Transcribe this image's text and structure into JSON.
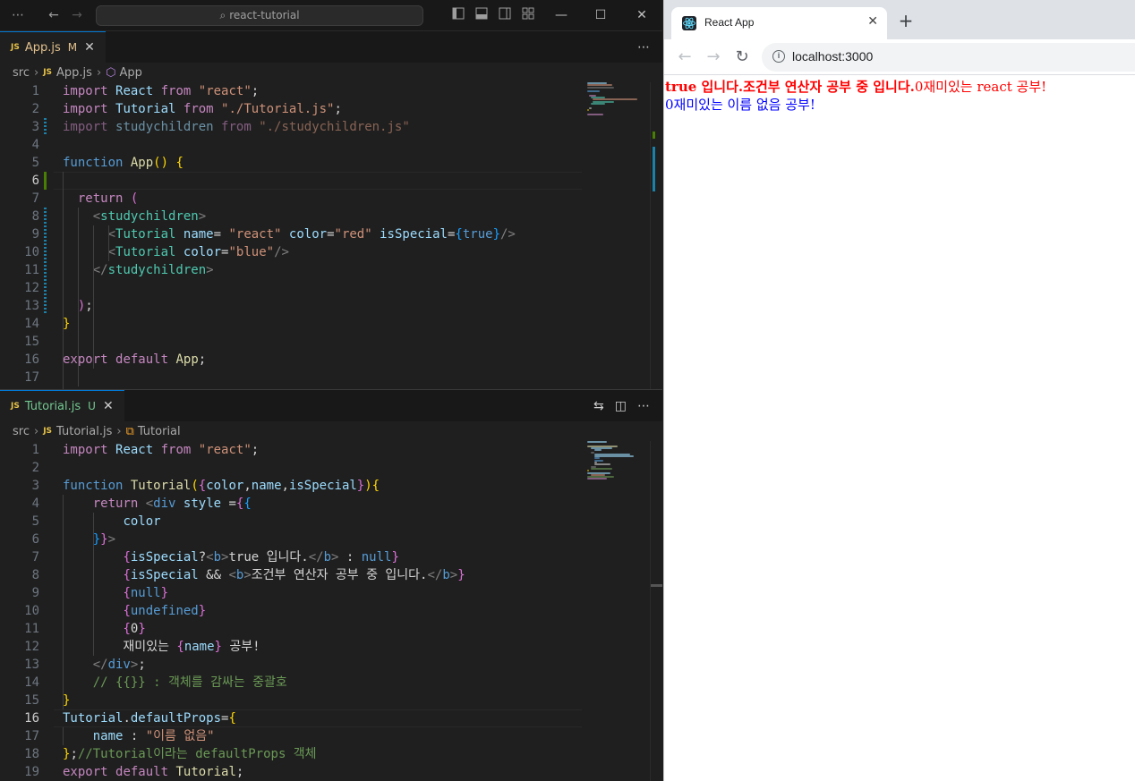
{
  "vscode": {
    "search_text": "react-tutorial",
    "top_pane": {
      "tab": {
        "filename": "App.js",
        "state": "M"
      },
      "breadcrumb": {
        "folder": "src",
        "file": "App.js",
        "symbol": "App"
      },
      "line_numbers": [
        "1",
        "2",
        "3",
        "4",
        "5",
        "6",
        "7",
        "8",
        "9",
        "10",
        "11",
        "12",
        "13",
        "14",
        "15",
        "16",
        "17"
      ],
      "current_line": "6"
    },
    "bottom_pane": {
      "tab": {
        "filename": "Tutorial.js",
        "state": "U"
      },
      "breadcrumb": {
        "folder": "src",
        "file": "Tutorial.js",
        "symbol": "Tutorial"
      },
      "line_numbers": [
        "1",
        "2",
        "3",
        "4",
        "5",
        "6",
        "7",
        "8",
        "9",
        "10",
        "11",
        "12",
        "13",
        "14",
        "15",
        "16",
        "17",
        "18",
        "19"
      ],
      "current_line": "16"
    }
  },
  "chrome": {
    "tab_title": "React App",
    "url": "localhost:3000",
    "output": {
      "line1_bold_true": "true",
      "line1_bold_1": " 입니다.",
      "line1_bold_2": "조건부 연산자 공부 중 입니다.",
      "line1_rest": "0재미있는 react 공부!",
      "line1_color": "#ff0000",
      "line2": "0재미있는 이름 없음 공부!",
      "line2_color": "#0000ff"
    }
  },
  "code_top": [
    [
      [
        "kc",
        "import"
      ],
      [
        "tx",
        " "
      ],
      [
        "vr",
        "React"
      ],
      [
        "tx",
        " "
      ],
      [
        "kc",
        "from"
      ],
      [
        "tx",
        " "
      ],
      [
        "st",
        "\"react\""
      ],
      [
        "tx",
        ";"
      ]
    ],
    [
      [
        "kc",
        "import"
      ],
      [
        "tx",
        " "
      ],
      [
        "vr",
        "Tutorial"
      ],
      [
        "tx",
        " "
      ],
      [
        "kc",
        "from"
      ],
      [
        "tx",
        " "
      ],
      [
        "st",
        "\"./Tutorial.js\""
      ],
      [
        "tx",
        ";"
      ]
    ],
    [
      [
        "kc dim",
        "import"
      ],
      [
        "tx",
        " "
      ],
      [
        "vr dim",
        "studychildren"
      ],
      [
        "tx",
        " "
      ],
      [
        "kc dim",
        "from"
      ],
      [
        "tx",
        " "
      ],
      [
        "st dim",
        "\"./studychildren.js\""
      ]
    ],
    [],
    [
      [
        "kw",
        "function"
      ],
      [
        "tx",
        " "
      ],
      [
        "fn",
        "App"
      ],
      [
        "br1",
        "()"
      ],
      [
        "tx",
        " "
      ],
      [
        "br1",
        "{"
      ]
    ],
    [],
    [
      [
        "tx",
        "  "
      ],
      [
        "kc",
        "return"
      ],
      [
        "tx",
        " "
      ],
      [
        "br2",
        "("
      ]
    ],
    [
      [
        "tx",
        "    "
      ],
      [
        "pt",
        "<"
      ],
      [
        "tg",
        "studychildren"
      ],
      [
        "pt",
        ">"
      ]
    ],
    [
      [
        "tx",
        "      "
      ],
      [
        "pt",
        "<"
      ],
      [
        "tg",
        "Tutorial"
      ],
      [
        "tx",
        " "
      ],
      [
        "vr",
        "name"
      ],
      [
        "tx",
        "= "
      ],
      [
        "st",
        "\"react\""
      ],
      [
        "tx",
        " "
      ],
      [
        "vr",
        "color"
      ],
      [
        "tx",
        "="
      ],
      [
        "st",
        "\"red\""
      ],
      [
        "tx",
        " "
      ],
      [
        "vr",
        "isSpecial"
      ],
      [
        "tx",
        "="
      ],
      [
        "br3",
        "{"
      ],
      [
        "kw",
        "true"
      ],
      [
        "br3",
        "}"
      ],
      [
        "pt",
        "/>"
      ]
    ],
    [
      [
        "tx",
        "      "
      ],
      [
        "pt",
        "<"
      ],
      [
        "tg",
        "Tutorial"
      ],
      [
        "tx",
        " "
      ],
      [
        "vr",
        "color"
      ],
      [
        "tx",
        "="
      ],
      [
        "st",
        "\"blue\""
      ],
      [
        "pt",
        "/>"
      ]
    ],
    [
      [
        "tx",
        "    "
      ],
      [
        "pt",
        "</"
      ],
      [
        "tg",
        "studychildren"
      ],
      [
        "pt",
        ">"
      ]
    ],
    [],
    [
      [
        "tx",
        "  "
      ],
      [
        "br2",
        ")"
      ],
      [
        "tx",
        ";"
      ]
    ],
    [
      [
        "br1",
        "}"
      ]
    ],
    [],
    [
      [
        "kc",
        "export"
      ],
      [
        "tx",
        " "
      ],
      [
        "kc",
        "default"
      ],
      [
        "tx",
        " "
      ],
      [
        "fn",
        "App"
      ],
      [
        "tx",
        ";"
      ]
    ],
    []
  ],
  "code_bottom": [
    [
      [
        "kc",
        "import"
      ],
      [
        "tx",
        " "
      ],
      [
        "vr",
        "React"
      ],
      [
        "tx",
        " "
      ],
      [
        "kc",
        "from"
      ],
      [
        "tx",
        " "
      ],
      [
        "st",
        "\"react\""
      ],
      [
        "tx",
        ";"
      ]
    ],
    [],
    [
      [
        "kw",
        "function"
      ],
      [
        "tx",
        " "
      ],
      [
        "fn",
        "Tutorial"
      ],
      [
        "br1",
        "("
      ],
      [
        "br2",
        "{"
      ],
      [
        "vr",
        "color"
      ],
      [
        "tx",
        ","
      ],
      [
        "vr",
        "name"
      ],
      [
        "tx",
        ","
      ],
      [
        "vr",
        "isSpecial"
      ],
      [
        "br2",
        "}"
      ],
      [
        "br1",
        ")"
      ],
      [
        "br1",
        "{"
      ]
    ],
    [
      [
        "tx",
        "    "
      ],
      [
        "kc",
        "return"
      ],
      [
        "tx",
        " "
      ],
      [
        "pt",
        "<"
      ],
      [
        "kw",
        "div"
      ],
      [
        "tx",
        " "
      ],
      [
        "vr",
        "style"
      ],
      [
        "tx",
        " ="
      ],
      [
        "br2",
        "{"
      ],
      [
        "br3",
        "{"
      ]
    ],
    [
      [
        "tx",
        "        "
      ],
      [
        "vr",
        "color"
      ]
    ],
    [
      [
        "tx",
        "    "
      ],
      [
        "br3",
        "}"
      ],
      [
        "br2",
        "}"
      ],
      [
        "pt",
        ">"
      ]
    ],
    [
      [
        "tx",
        "        "
      ],
      [
        "br2",
        "{"
      ],
      [
        "vr",
        "isSpecial"
      ],
      [
        "tx",
        "?"
      ],
      [
        "pt",
        "<"
      ],
      [
        "kw",
        "b"
      ],
      [
        "pt",
        ">"
      ],
      [
        "tx",
        "true 입니다."
      ],
      [
        "pt",
        "</"
      ],
      [
        "kw",
        "b"
      ],
      [
        "pt",
        ">"
      ],
      [
        "tx",
        " : "
      ],
      [
        "kw",
        "null"
      ],
      [
        "br2",
        "}"
      ]
    ],
    [
      [
        "tx",
        "        "
      ],
      [
        "br2",
        "{"
      ],
      [
        "vr",
        "isSpecial"
      ],
      [
        "tx",
        " && "
      ],
      [
        "pt",
        "<"
      ],
      [
        "kw",
        "b"
      ],
      [
        "pt",
        ">"
      ],
      [
        "tx",
        "조건부 연산자 공부 중 입니다."
      ],
      [
        "pt",
        "</"
      ],
      [
        "kw",
        "b"
      ],
      [
        "pt",
        ">"
      ],
      [
        "br2",
        "}"
      ]
    ],
    [
      [
        "tx",
        "        "
      ],
      [
        "br2",
        "{"
      ],
      [
        "kw",
        "null"
      ],
      [
        "br2",
        "}"
      ]
    ],
    [
      [
        "tx",
        "        "
      ],
      [
        "br2",
        "{"
      ],
      [
        "kw",
        "undefined"
      ],
      [
        "br2",
        "}"
      ]
    ],
    [
      [
        "tx",
        "        "
      ],
      [
        "br2",
        "{"
      ],
      [
        "tx",
        "0"
      ],
      [
        "br2",
        "}"
      ]
    ],
    [
      [
        "tx",
        "        재미있는 "
      ],
      [
        "br2",
        "{"
      ],
      [
        "vr",
        "name"
      ],
      [
        "br2",
        "}"
      ],
      [
        "tx",
        " 공부!"
      ]
    ],
    [
      [
        "tx",
        "    "
      ],
      [
        "pt",
        "</"
      ],
      [
        "kw",
        "div"
      ],
      [
        "pt",
        ">"
      ],
      [
        "tx",
        ";"
      ]
    ],
    [
      [
        "tx",
        "    "
      ],
      [
        "cm",
        "// {{}} : 객체를 감싸는 중괄호"
      ]
    ],
    [
      [
        "br1",
        "}"
      ]
    ],
    [
      [
        "vr",
        "Tutorial"
      ],
      [
        "tx",
        "."
      ],
      [
        "vr",
        "defaultProps"
      ],
      [
        "tx",
        "="
      ],
      [
        "br1",
        "{"
      ]
    ],
    [
      [
        "tx",
        "    "
      ],
      [
        "vr",
        "name"
      ],
      [
        "tx",
        " : "
      ],
      [
        "st",
        "\"이름 없음\""
      ]
    ],
    [
      [
        "br1",
        "}"
      ],
      [
        "tx",
        ";"
      ],
      [
        "cm",
        "//Tutorial이라는 defaultProps 객체"
      ]
    ],
    [
      [
        "kc",
        "export"
      ],
      [
        "tx",
        " "
      ],
      [
        "kc",
        "default"
      ],
      [
        "tx",
        " "
      ],
      [
        "fn",
        "Tutorial"
      ],
      [
        "tx",
        ";"
      ]
    ]
  ],
  "colors": {
    "accent": "#0078d4",
    "editor_bg": "#1f1f1f"
  }
}
